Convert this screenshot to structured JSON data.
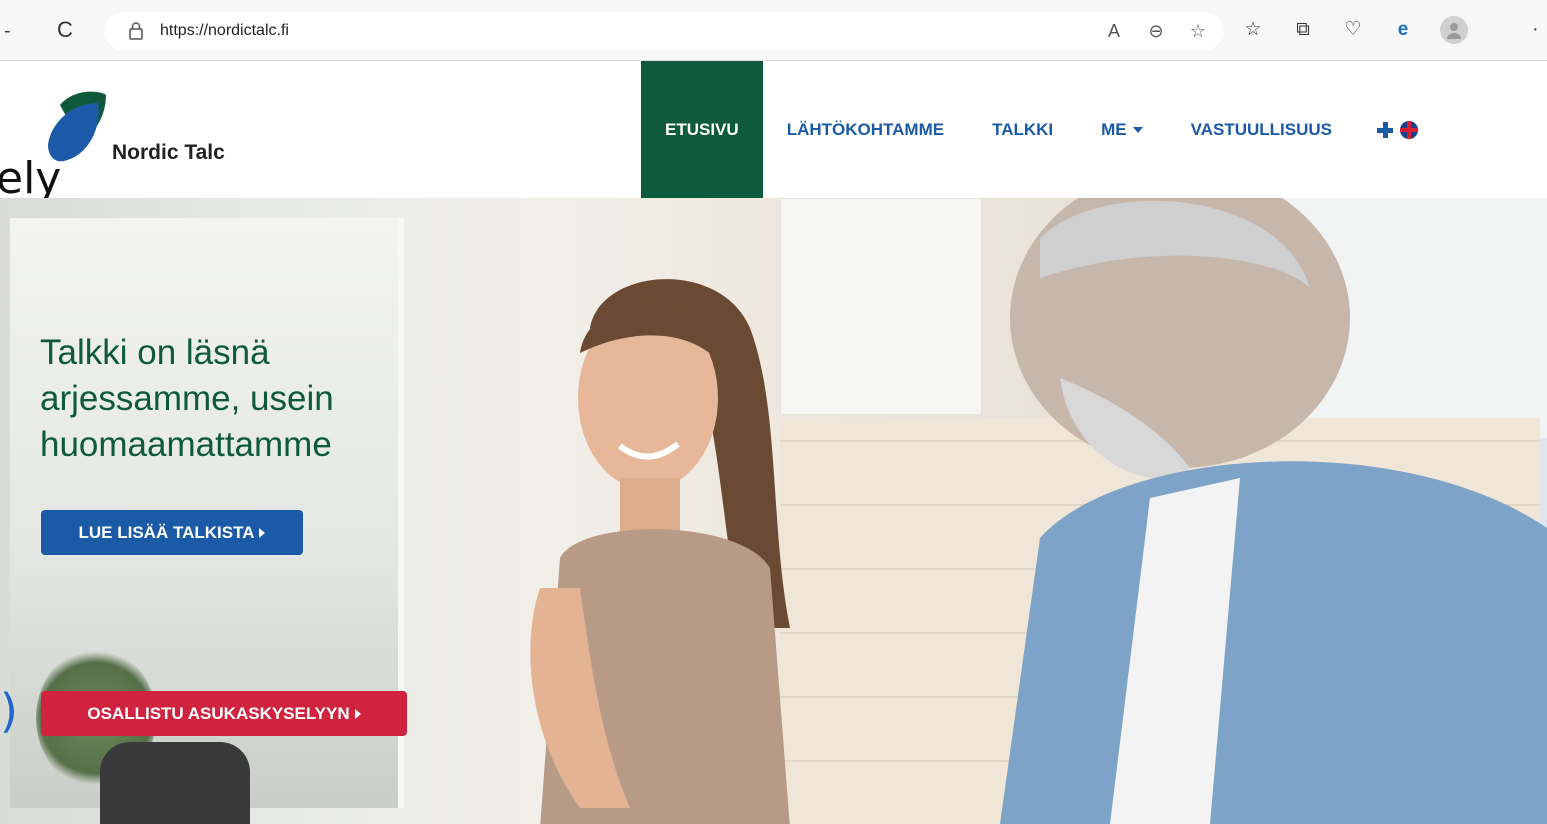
{
  "browser": {
    "url": "https://nordictalc.fi",
    "back_stub": "-",
    "more_stub": "·",
    "reload_glyph": "C"
  },
  "site": {
    "logo_text": "Nordic Talc",
    "overlay_text": "ely",
    "overlay_paren": ")",
    "nav": {
      "items": [
        {
          "label": "ETUSIVU",
          "active": true
        },
        {
          "label": "LÄHTÖKOHTAMME",
          "active": false
        },
        {
          "label": "TALKKI",
          "active": false
        },
        {
          "label": "ME",
          "active": false,
          "has_dropdown": true
        },
        {
          "label": "VASTUULLISUUS",
          "active": false
        }
      ]
    },
    "colors": {
      "brand_green": "#0f5a3c",
      "nav_blue": "#1b5aa6",
      "cta_red": "#d0233f"
    }
  },
  "hero": {
    "title_lines": [
      "Talkki on läsnä",
      "arjessamme, usein",
      "huomaamattamme"
    ],
    "primary_button": "LUE LISÄÄ TALKISTA",
    "survey_button": "OSALLISTU ASUKASKYSELYYN"
  }
}
